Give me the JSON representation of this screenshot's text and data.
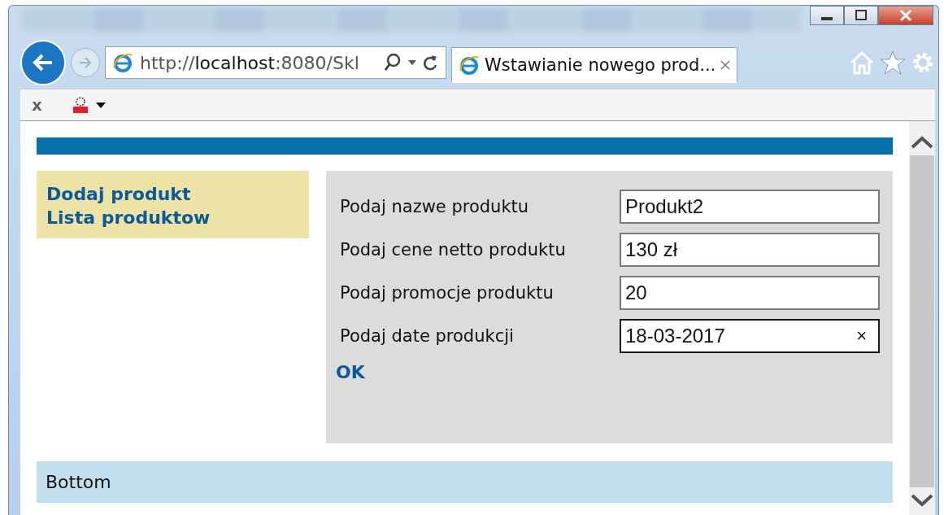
{
  "browser": {
    "address": {
      "scheme": "http://",
      "host": "localhost",
      "rest": ":8080/Skl"
    },
    "tabs": [
      {
        "title": "Wstawianie nowego prod...",
        "selected": true
      }
    ],
    "toolbar": {
      "close_label": "x"
    }
  },
  "page": {
    "sidebar": {
      "links": [
        "Dodaj produkt",
        "Lista produktow"
      ]
    },
    "form": {
      "fields": [
        {
          "label": "Podaj nazwe produktu",
          "value": "Produkt2",
          "focused": false
        },
        {
          "label": "Podaj cene netto produktu",
          "value": "130 zł",
          "focused": false
        },
        {
          "label": "Podaj promocje produktu",
          "value": "20",
          "focused": false
        },
        {
          "label": "Podaj date produkcji",
          "value": "18-03-2017",
          "focused": true,
          "clear_label": "×"
        }
      ],
      "submit": "OK"
    },
    "footer": "Bottom"
  }
}
